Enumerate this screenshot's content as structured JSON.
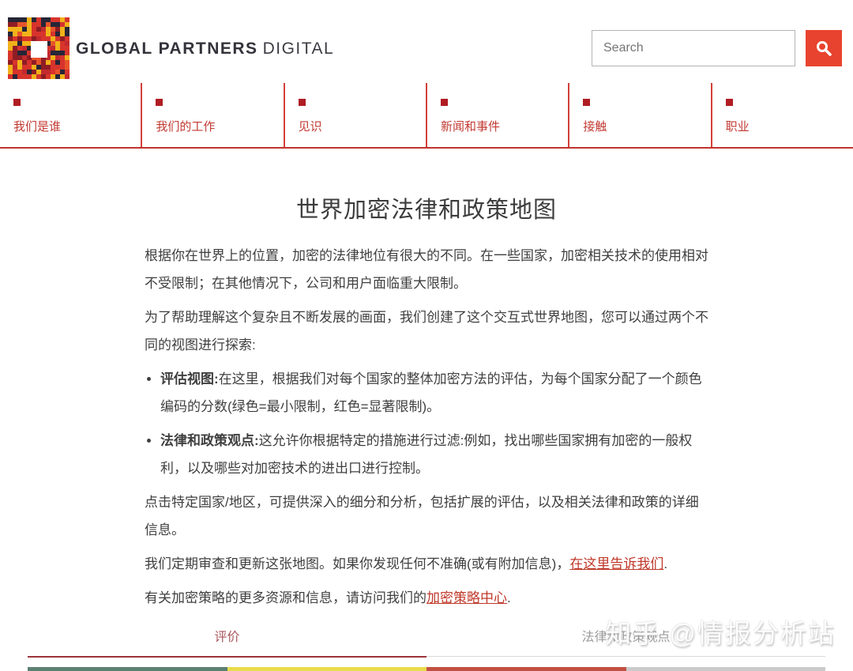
{
  "brand": {
    "bold": "GLOBAL PARTNERS",
    "light": "DIGITAL"
  },
  "search": {
    "placeholder": "Search",
    "button_color": "#e8432e"
  },
  "logo": {
    "palette": [
      "#d7342c",
      "#e8542a",
      "#f1b21a",
      "#d7342c",
      "#262637",
      "#8f1d24",
      "#f1b21a",
      "#c22a2f"
    ]
  },
  "nav": {
    "items": [
      {
        "label": "我们是谁"
      },
      {
        "label": "我们的工作"
      },
      {
        "label": "见识"
      },
      {
        "label": "新闻和事件"
      },
      {
        "label": "接触"
      },
      {
        "label": "职业"
      }
    ]
  },
  "article": {
    "title": "世界加密法律和政策地图",
    "p1": "根据你在世界上的位置，加密的法律地位有很大的不同。在一些国家，加密相关技术的使用相对不受限制；在其他情况下，公司和用户面临重大限制。",
    "p2": "为了帮助理解这个复杂且不断发展的画面，我们创建了这个交互式世界地图，您可以通过两个不同的视图进行探索:",
    "bullets": [
      {
        "lead": "评估视图:",
        "text": "在这里，根据我们对每个国家的整体加密方法的评估，为每个国家分配了一个颜色编码的分数(绿色=最小限制，红色=显著限制)。"
      },
      {
        "lead": "法律和政策观点:",
        "text": "这允许你根据特定的措施进行过滤:例如，找出哪些国家拥有加密的一般权利，以及哪些对加密技术的进出口进行控制。"
      }
    ],
    "p3": "点击特定国家/地区，可提供深入的细分和分析，包括扩展的评估，以及相关法律和政策的详细信息。",
    "p4_before": "我们定期审查和更新这张地图。如果你发现任何不准确(或有附加信息)，",
    "p4_link": "在这里告诉我们",
    "p4_after": ".",
    "p5_before": "有关加密策略的更多资源和信息，请访问我们的",
    "p5_link": "加密策略中心",
    "p5_after": "."
  },
  "tabs": {
    "active": "评价",
    "inactive": "法律和政策观点",
    "active_color": "#9c343c",
    "inactive_color": "#d9d9d9"
  },
  "legend": {
    "colors": [
      "#5b8173",
      "#e8dc4a",
      "#c25043",
      "#cbcbcb"
    ]
  },
  "watermark": "知乎 @情报分析站"
}
